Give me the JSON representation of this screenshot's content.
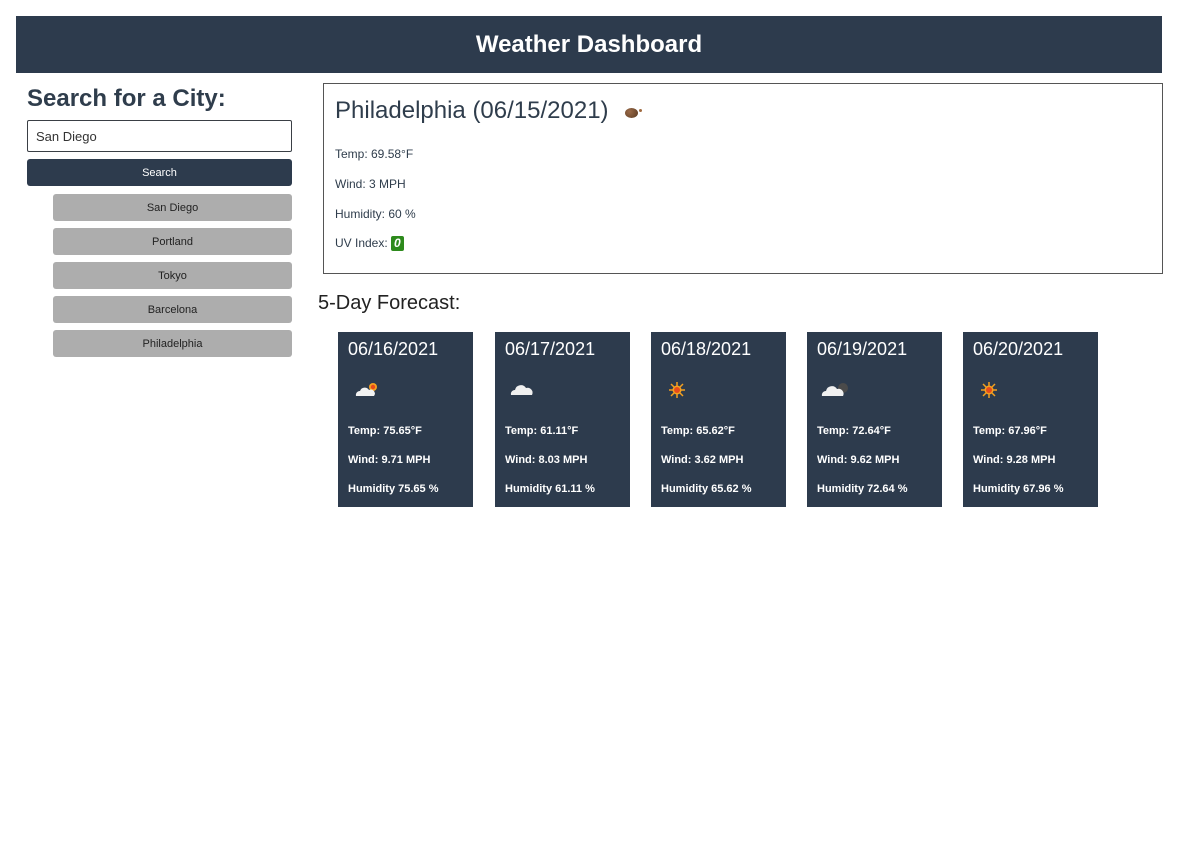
{
  "header": {
    "title": "Weather Dashboard"
  },
  "search": {
    "heading": "Search for a City:",
    "input_value": "San Diego",
    "placeholder": "",
    "button_label": "Search"
  },
  "history": [
    "San Diego",
    "Portland",
    "Tokyo",
    "Barcelona",
    "Philadelphia"
  ],
  "current": {
    "title": "Philadelphia (06/15/2021)",
    "icon": "moon-icon",
    "temp": "Temp: 69.58°F",
    "wind": "Wind: 3 MPH",
    "humidity": "Humidity: 60 %",
    "uv_label": "UV Index:",
    "uv_value": "0",
    "uv_color": "#2d8a1c"
  },
  "forecast": {
    "heading": "5-Day Forecast:",
    "days": [
      {
        "date": "06/16/2021",
        "icon": "partly-sunny-icon",
        "temp": "Temp: 75.65°F",
        "wind": "Wind: 9.71 MPH",
        "humidity": "Humidity 75.65 %"
      },
      {
        "date": "06/17/2021",
        "icon": "cloud-icon",
        "temp": "Temp: 61.11°F",
        "wind": "Wind: 8.03 MPH",
        "humidity": "Humidity 61.11 %"
      },
      {
        "date": "06/18/2021",
        "icon": "sun-icon",
        "temp": "Temp: 65.62°F",
        "wind": "Wind: 3.62 MPH",
        "humidity": "Humidity 65.62 %"
      },
      {
        "date": "06/19/2021",
        "icon": "cloud-moon-icon",
        "temp": "Temp: 72.64°F",
        "wind": "Wind: 9.62 MPH",
        "humidity": "Humidity 72.64 %"
      },
      {
        "date": "06/20/2021",
        "icon": "sun-icon",
        "temp": "Temp: 67.96°F",
        "wind": "Wind: 9.28 MPH",
        "humidity": "Humidity 67.96 %"
      }
    ]
  },
  "colors": {
    "header_bg": "#2d3b4d",
    "card_bg": "#2d3b4d",
    "history_bg": "#adadad"
  }
}
